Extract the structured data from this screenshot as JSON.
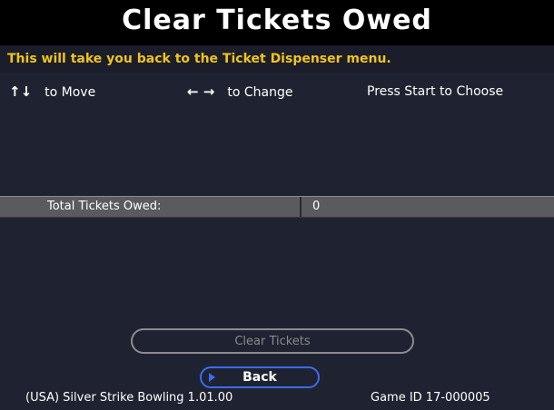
{
  "header": {
    "title": "Clear Tickets Owed"
  },
  "description": "This will take you back to the Ticket Dispenser menu.",
  "help": {
    "move_arrows": "↑↓",
    "move_text": "to Move",
    "change_arrows": "← →",
    "change_text": "to Change",
    "choose_text": "Press Start to Choose"
  },
  "settings": {
    "total_tickets_label": "Total Tickets Owed:",
    "total_tickets_value": "0"
  },
  "buttons": {
    "clear_tickets": "Clear Tickets",
    "back": "Back"
  },
  "footer": {
    "game_version": "(USA) Silver Strike Bowling 1.01.00",
    "game_id": "Game ID 17-000005"
  },
  "colors": {
    "description_text": "#f0c419",
    "panel_background": "#1f2331",
    "selected_button_border": "#3a6cf0"
  }
}
